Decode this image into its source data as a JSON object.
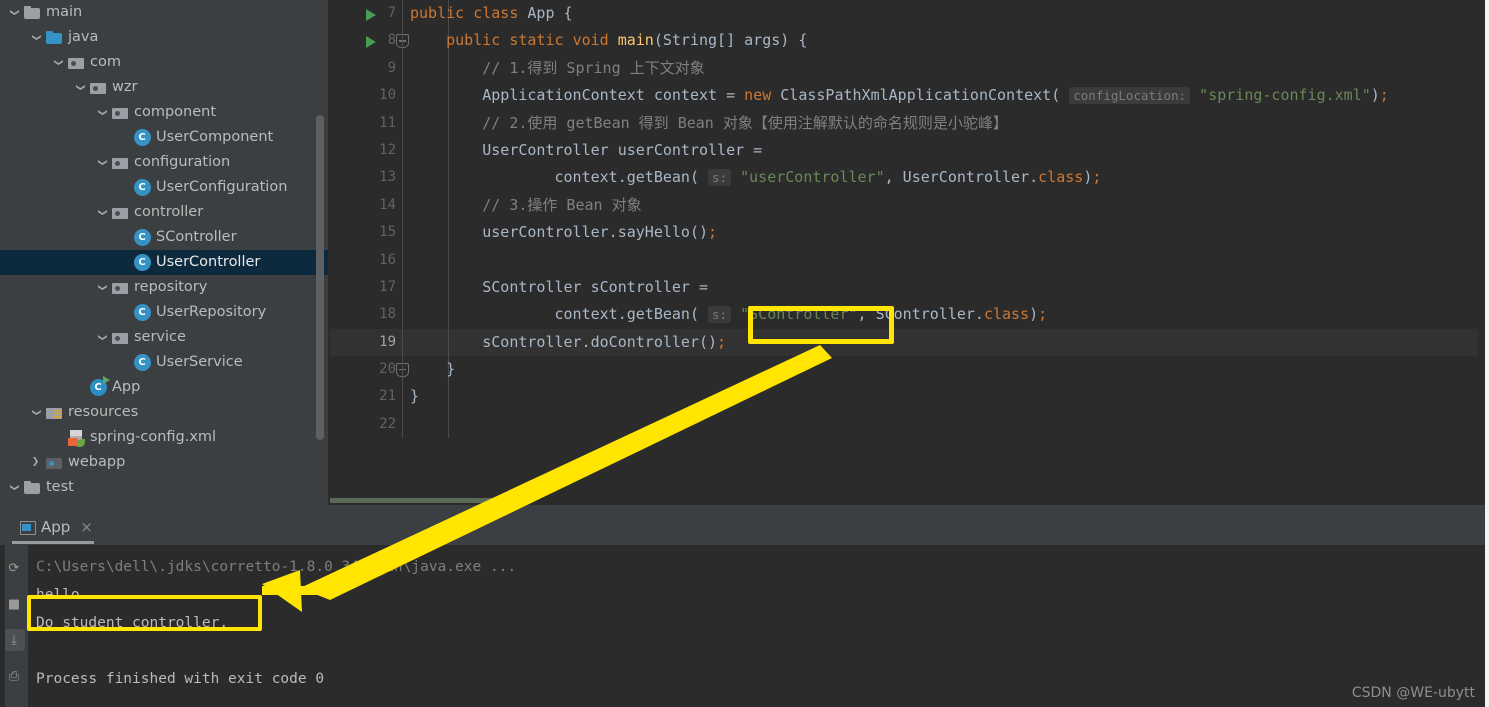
{
  "sidebar": {
    "scrollbar": "vertical-scrollbar",
    "items": [
      {
        "label": "main",
        "indent": 0,
        "arrow": "down",
        "icon": "folder-grey",
        "selected": false
      },
      {
        "label": "java",
        "indent": 1,
        "arrow": "down",
        "icon": "folder-blue",
        "selected": false
      },
      {
        "label": "com",
        "indent": 2,
        "arrow": "down",
        "icon": "package",
        "selected": false
      },
      {
        "label": "wzr",
        "indent": 3,
        "arrow": "down",
        "icon": "package",
        "selected": false
      },
      {
        "label": "component",
        "indent": 4,
        "arrow": "down",
        "icon": "package",
        "selected": false
      },
      {
        "label": "UserComponent",
        "indent": 5,
        "arrow": "none",
        "icon": "java-class",
        "selected": false
      },
      {
        "label": "configuration",
        "indent": 4,
        "arrow": "down",
        "icon": "package",
        "selected": false
      },
      {
        "label": "UserConfiguration",
        "indent": 5,
        "arrow": "none",
        "icon": "java-class",
        "selected": false
      },
      {
        "label": "controller",
        "indent": 4,
        "arrow": "down",
        "icon": "package",
        "selected": false
      },
      {
        "label": "SController",
        "indent": 5,
        "arrow": "none",
        "icon": "java-class",
        "selected": false
      },
      {
        "label": "UserController",
        "indent": 5,
        "arrow": "none",
        "icon": "java-class",
        "selected": true
      },
      {
        "label": "repository",
        "indent": 4,
        "arrow": "down",
        "icon": "package",
        "selected": false
      },
      {
        "label": "UserRepository",
        "indent": 5,
        "arrow": "none",
        "icon": "java-class",
        "selected": false
      },
      {
        "label": "service",
        "indent": 4,
        "arrow": "down",
        "icon": "package",
        "selected": false
      },
      {
        "label": "UserService",
        "indent": 5,
        "arrow": "none",
        "icon": "java-class",
        "selected": false
      },
      {
        "label": "App",
        "indent": 3,
        "arrow": "none",
        "icon": "java-class-runnable",
        "selected": false
      },
      {
        "label": "resources",
        "indent": 1,
        "arrow": "down",
        "icon": "folder-resources",
        "selected": false
      },
      {
        "label": "spring-config.xml",
        "indent": 2,
        "arrow": "none",
        "icon": "xml-file",
        "selected": false
      },
      {
        "label": "webapp",
        "indent": 1,
        "arrow": "right",
        "icon": "package-webapp",
        "selected": false
      },
      {
        "label": "test",
        "indent": 0,
        "arrow": "down",
        "icon": "folder-grey",
        "selected": false
      }
    ]
  },
  "editor": {
    "lines": [
      {
        "num": "7",
        "run": true,
        "fold": false,
        "current": false,
        "tokens": [
          {
            "t": "public ",
            "c": "kw"
          },
          {
            "t": "class ",
            "c": "kw"
          },
          {
            "t": "App {",
            "c": "txt"
          }
        ]
      },
      {
        "num": "8",
        "run": true,
        "fold": true,
        "current": false,
        "tokens": [
          {
            "t": "    ",
            "c": "txt"
          },
          {
            "t": "public ",
            "c": "kw"
          },
          {
            "t": "static ",
            "c": "kw"
          },
          {
            "t": "void ",
            "c": "kw"
          },
          {
            "t": "main",
            "c": "fn"
          },
          {
            "t": "(String[] args) {",
            "c": "txt"
          }
        ]
      },
      {
        "num": "9",
        "run": false,
        "fold": false,
        "current": false,
        "tokens": [
          {
            "t": "        // 1.得到 Spring 上下文对象",
            "c": "cmt"
          }
        ]
      },
      {
        "num": "10",
        "run": false,
        "fold": false,
        "current": false,
        "tokens": [
          {
            "t": "        ApplicationContext context = ",
            "c": "txt"
          },
          {
            "t": "new ",
            "c": "kw"
          },
          {
            "t": "ClassPathXmlApplicationContext( ",
            "c": "txt"
          },
          {
            "t": "configLocation:",
            "c": "hint"
          },
          {
            "t": " ",
            "c": "txt"
          },
          {
            "t": "\"spring-config.xml\"",
            "c": "str"
          },
          {
            "t": ")",
            "c": "txt"
          },
          {
            "t": ";",
            "c": "kw"
          }
        ]
      },
      {
        "num": "11",
        "run": false,
        "fold": false,
        "current": false,
        "tokens": [
          {
            "t": "        // 2.使用 getBean 得到 Bean 对象【使用注解默认的命名规则是小驼峰】",
            "c": "cmt"
          }
        ]
      },
      {
        "num": "12",
        "run": false,
        "fold": false,
        "current": false,
        "tokens": [
          {
            "t": "        UserController userController =",
            "c": "txt"
          }
        ]
      },
      {
        "num": "13",
        "run": false,
        "fold": false,
        "current": false,
        "tokens": [
          {
            "t": "                context.",
            "c": "txt"
          },
          {
            "t": "getBean",
            "c": "txt"
          },
          {
            "t": "( ",
            "c": "txt"
          },
          {
            "t": "s:",
            "c": "hint"
          },
          {
            "t": " ",
            "c": "txt"
          },
          {
            "t": "\"userController\"",
            "c": "str"
          },
          {
            "t": ", UserController.",
            "c": "txt"
          },
          {
            "t": "class",
            "c": "kw"
          },
          {
            "t": ")",
            "c": "txt"
          },
          {
            "t": ";",
            "c": "kw"
          }
        ]
      },
      {
        "num": "14",
        "run": false,
        "fold": false,
        "current": false,
        "tokens": [
          {
            "t": "        // 3.操作 Bean 对象",
            "c": "cmt"
          }
        ]
      },
      {
        "num": "15",
        "run": false,
        "fold": false,
        "current": false,
        "tokens": [
          {
            "t": "        userController.sayHello()",
            "c": "txt"
          },
          {
            "t": ";",
            "c": "kw"
          }
        ]
      },
      {
        "num": "16",
        "run": false,
        "fold": false,
        "current": false,
        "tokens": []
      },
      {
        "num": "17",
        "run": false,
        "fold": false,
        "current": false,
        "tokens": [
          {
            "t": "        SController sController =",
            "c": "txt"
          }
        ]
      },
      {
        "num": "18",
        "run": false,
        "fold": false,
        "current": false,
        "tokens": [
          {
            "t": "                context.getBean( ",
            "c": "txt"
          },
          {
            "t": "s:",
            "c": "hint"
          },
          {
            "t": " ",
            "c": "txt"
          },
          {
            "t": "\"SController\"",
            "c": "str"
          },
          {
            "t": ", SController.",
            "c": "txt"
          },
          {
            "t": "class",
            "c": "kw"
          },
          {
            "t": ")",
            "c": "txt"
          },
          {
            "t": ";",
            "c": "kw"
          }
        ]
      },
      {
        "num": "19",
        "run": false,
        "fold": false,
        "current": true,
        "tokens": [
          {
            "t": "        sController.doController()",
            "c": "txt"
          },
          {
            "t": ";",
            "c": "kw"
          }
        ]
      },
      {
        "num": "20",
        "run": false,
        "fold": true,
        "current": false,
        "tokens": [
          {
            "t": "    }",
            "c": "txt"
          }
        ]
      },
      {
        "num": "21",
        "run": false,
        "fold": false,
        "current": false,
        "tokens": [
          {
            "t": "}",
            "c": "txt"
          }
        ]
      },
      {
        "num": "22",
        "run": false,
        "fold": false,
        "current": false,
        "tokens": []
      }
    ]
  },
  "console": {
    "tab": {
      "label": "App",
      "close": "×",
      "icon": "run-window-icon"
    },
    "gutter_buttons": [
      {
        "name": "rerun-button",
        "glyph": "⟳"
      },
      {
        "name": "stop-button",
        "glyph": "■"
      },
      {
        "name": "trace-button",
        "glyph": "⤓"
      },
      {
        "name": "print-button",
        "glyph": "⎙"
      }
    ],
    "output": [
      {
        "text": "C:\\Users\\dell\\.jdks\\corretto-1.8.0_342\\bin\\java.exe ...",
        "dim": true
      },
      {
        "text": "hello",
        "dim": false
      },
      {
        "text": "Do student controller.",
        "dim": false
      },
      {
        "text": "",
        "dim": false
      },
      {
        "text": "Process finished with exit code 0",
        "dim": false
      }
    ]
  },
  "annotations": {
    "highlight_color": "#FFE500",
    "code_highlight_text": "\"SController\"",
    "console_highlight_text": "Do student controller."
  },
  "watermark": {
    "text": "CSDN @WE-ubytt"
  }
}
